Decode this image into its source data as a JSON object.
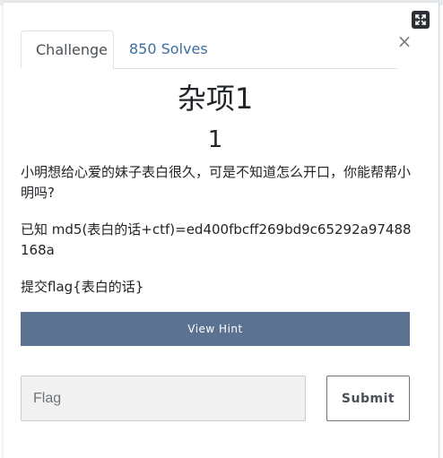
{
  "modal": {
    "tabs": [
      {
        "label": "Challenge"
      },
      {
        "label": "850 Solves"
      }
    ],
    "close_glyph": "×",
    "expand_icon": "expand-arrows-icon"
  },
  "challenge": {
    "name": "杂项1",
    "value": "1",
    "description": [
      "小明想给心爱的妹子表白很久，可是不知道怎么开口，你能帮帮小明吗?",
      "已知 md5(表白的话+ctf)=ed400fbcff269bd9c65292a97488168a",
      "提交flag{表白的话}"
    ]
  },
  "actions": {
    "hint_label": "View Hint",
    "flag_placeholder": "Flag",
    "flag_value": "",
    "submit_label": "Submit"
  },
  "colors": {
    "hint_bg": "#5b7290",
    "tab_link": "#3c6e9e",
    "expand_bg": "#2b2f33"
  }
}
